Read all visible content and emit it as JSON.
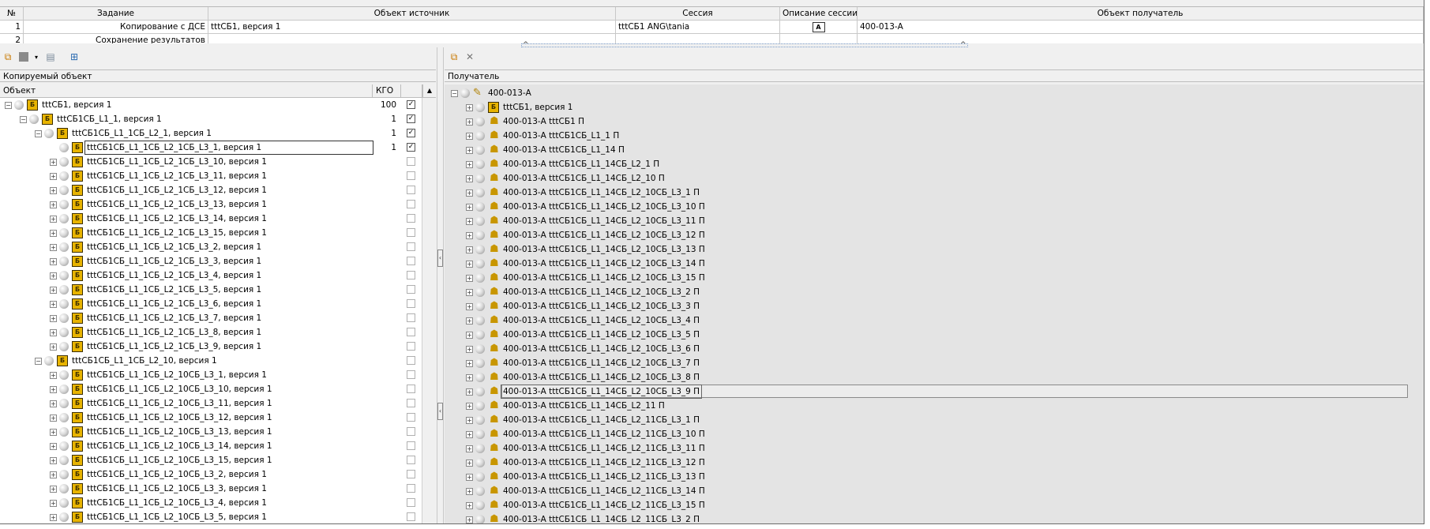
{
  "top_grid": {
    "headers": [
      "№",
      "Задание",
      "Объект источник",
      "Сессия",
      "Описание сессии",
      "Объект получатель"
    ],
    "rows": [
      {
        "num": "1",
        "task": "Копирование с ДСЕ",
        "source": "tttCБ1, версия 1",
        "session": "tttCБ1 ANG\\tania",
        "desc_icon": "A",
        "target": "400-013-А"
      },
      {
        "num": "2",
        "task": "Сохранение результатов",
        "source": "",
        "session": "",
        "desc_icon": "",
        "target": ""
      }
    ]
  },
  "left_panel": {
    "caption": "Копируемый объект",
    "col_object": "Объект",
    "col_kgo": "КГО",
    "rows": [
      {
        "label": "tttCБ1, версия 1",
        "exp": "−",
        "kgo": "100",
        "checked": true
      },
      {
        "label": "tttCБ1CБ_L1_1, версия 1",
        "exp": "−",
        "kgo": "1",
        "checked": true
      },
      {
        "label": "tttCБ1CБ_L1_1CБ_L2_1, версия 1",
        "exp": "−",
        "kgo": "1",
        "checked": true
      },
      {
        "label": "tttCБ1CБ_L1_1CБ_L2_1CБ_L3_1, версия 1",
        "exp": "",
        "kgo": "1",
        "checked": true
      },
      {
        "label": "tttCБ1CБ_L1_1CБ_L2_1CБ_L3_10, версия 1",
        "exp": "+",
        "kgo": "",
        "checked": false
      },
      {
        "label": "tttCБ1CБ_L1_1CБ_L2_1CБ_L3_11, версия 1",
        "exp": "+",
        "kgo": "",
        "checked": false
      },
      {
        "label": "tttCБ1CБ_L1_1CБ_L2_1CБ_L3_12, версия 1",
        "exp": "+",
        "kgo": "",
        "checked": false
      },
      {
        "label": "tttCБ1CБ_L1_1CБ_L2_1CБ_L3_13, версия 1",
        "exp": "+",
        "kgo": "",
        "checked": false
      },
      {
        "label": "tttCБ1CБ_L1_1CБ_L2_1CБ_L3_14, версия 1",
        "exp": "+",
        "kgo": "",
        "checked": false
      },
      {
        "label": "tttCБ1CБ_L1_1CБ_L2_1CБ_L3_15, версия 1",
        "exp": "+",
        "kgo": "",
        "checked": false
      },
      {
        "label": "tttCБ1CБ_L1_1CБ_L2_1CБ_L3_2, версия 1",
        "exp": "+",
        "kgo": "",
        "checked": false
      },
      {
        "label": "tttCБ1CБ_L1_1CБ_L2_1CБ_L3_3, версия 1",
        "exp": "+",
        "kgo": "",
        "checked": false
      },
      {
        "label": "tttCБ1CБ_L1_1CБ_L2_1CБ_L3_4, версия 1",
        "exp": "+",
        "kgo": "",
        "checked": false
      },
      {
        "label": "tttCБ1CБ_L1_1CБ_L2_1CБ_L3_5, версия 1",
        "exp": "+",
        "kgo": "",
        "checked": false
      },
      {
        "label": "tttCБ1CБ_L1_1CБ_L2_1CБ_L3_6, версия 1",
        "exp": "+",
        "kgo": "",
        "checked": false
      },
      {
        "label": "tttCБ1CБ_L1_1CБ_L2_1CБ_L3_7, версия 1",
        "exp": "+",
        "kgo": "",
        "checked": false
      },
      {
        "label": "tttCБ1CБ_L1_1CБ_L2_1CБ_L3_8, версия 1",
        "exp": "+",
        "kgo": "",
        "checked": false
      },
      {
        "label": "tttCБ1CБ_L1_1CБ_L2_1CБ_L3_9, версия 1",
        "exp": "+",
        "kgo": "",
        "checked": false
      },
      {
        "label": "tttCБ1CБ_L1_1CБ_L2_10, версия 1",
        "exp": "−",
        "kgo": "",
        "checked": false
      },
      {
        "label": "tttCБ1CБ_L1_1CБ_L2_10CБ_L3_1, версия 1",
        "exp": "+",
        "kgo": "",
        "checked": false
      },
      {
        "label": "tttCБ1CБ_L1_1CБ_L2_10CБ_L3_10, версия 1",
        "exp": "+",
        "kgo": "",
        "checked": false
      },
      {
        "label": "tttCБ1CБ_L1_1CБ_L2_10CБ_L3_11, версия 1",
        "exp": "+",
        "kgo": "",
        "checked": false
      },
      {
        "label": "tttCБ1CБ_L1_1CБ_L2_10CБ_L3_12, версия 1",
        "exp": "+",
        "kgo": "",
        "checked": false
      },
      {
        "label": "tttCБ1CБ_L1_1CБ_L2_10CБ_L3_13, версия 1",
        "exp": "+",
        "kgo": "",
        "checked": false
      },
      {
        "label": "tttCБ1CБ_L1_1CБ_L2_10CБ_L3_14, версия 1",
        "exp": "+",
        "kgo": "",
        "checked": false
      },
      {
        "label": "tttCБ1CБ_L1_1CБ_L2_10CБ_L3_15, версия 1",
        "exp": "+",
        "kgo": "",
        "checked": false
      },
      {
        "label": "tttCБ1CБ_L1_1CБ_L2_10CБ_L3_2, версия 1",
        "exp": "+",
        "kgo": "",
        "checked": false
      },
      {
        "label": "tttCБ1CБ_L1_1CБ_L2_10CБ_L3_3, версия 1",
        "exp": "+",
        "kgo": "",
        "checked": false
      },
      {
        "label": "tttCБ1CБ_L1_1CБ_L2_10CБ_L3_4, версия 1",
        "exp": "+",
        "kgo": "",
        "checked": false
      },
      {
        "label": "tttCБ1CБ_L1_1CБ_L2_10CБ_L3_5, версия 1",
        "exp": "+",
        "kgo": "",
        "checked": false
      }
    ]
  },
  "right_panel": {
    "caption": "Получатель",
    "rows": [
      {
        "label": "400-013-А",
        "exp": "−",
        "icon": "root"
      },
      {
        "label": "tttCБ1, версия 1",
        "exp": "+",
        "icon": "asm"
      },
      {
        "label": "400-013-А tttCБ1 П",
        "exp": "+",
        "icon": "prt"
      },
      {
        "label": "400-013-А tttCБ1CБ_L1_1 П",
        "exp": "+",
        "icon": "prt"
      },
      {
        "label": "400-013-А tttCБ1CБ_L1_14 П",
        "exp": "+",
        "icon": "prt"
      },
      {
        "label": "400-013-А tttCБ1CБ_L1_14CБ_L2_1 П",
        "exp": "+",
        "icon": "prt"
      },
      {
        "label": "400-013-А tttCБ1CБ_L1_14CБ_L2_10 П",
        "exp": "+",
        "icon": "prt"
      },
      {
        "label": "400-013-А tttCБ1CБ_L1_14CБ_L2_10CБ_L3_1 П",
        "exp": "+",
        "icon": "prt"
      },
      {
        "label": "400-013-А tttCБ1CБ_L1_14CБ_L2_10CБ_L3_10 П",
        "exp": "+",
        "icon": "prt"
      },
      {
        "label": "400-013-А tttCБ1CБ_L1_14CБ_L2_10CБ_L3_11 П",
        "exp": "+",
        "icon": "prt"
      },
      {
        "label": "400-013-А tttCБ1CБ_L1_14CБ_L2_10CБ_L3_12 П",
        "exp": "+",
        "icon": "prt"
      },
      {
        "label": "400-013-А tttCБ1CБ_L1_14CБ_L2_10CБ_L3_13 П",
        "exp": "+",
        "icon": "prt"
      },
      {
        "label": "400-013-А tttCБ1CБ_L1_14CБ_L2_10CБ_L3_14 П",
        "exp": "+",
        "icon": "prt"
      },
      {
        "label": "400-013-А tttCБ1CБ_L1_14CБ_L2_10CБ_L3_15 П",
        "exp": "+",
        "icon": "prt"
      },
      {
        "label": "400-013-А tttCБ1CБ_L1_14CБ_L2_10CБ_L3_2 П",
        "exp": "+",
        "icon": "prt"
      },
      {
        "label": "400-013-А tttCБ1CБ_L1_14CБ_L2_10CБ_L3_3 П",
        "exp": "+",
        "icon": "prt"
      },
      {
        "label": "400-013-А tttCБ1CБ_L1_14CБ_L2_10CБ_L3_4 П",
        "exp": "+",
        "icon": "prt"
      },
      {
        "label": "400-013-А tttCБ1CБ_L1_14CБ_L2_10CБ_L3_5 П",
        "exp": "+",
        "icon": "prt"
      },
      {
        "label": "400-013-А tttCБ1CБ_L1_14CБ_L2_10CБ_L3_6 П",
        "exp": "+",
        "icon": "prt"
      },
      {
        "label": "400-013-А tttCБ1CБ_L1_14CБ_L2_10CБ_L3_7 П",
        "exp": "+",
        "icon": "prt"
      },
      {
        "label": "400-013-А tttCБ1CБ_L1_14CБ_L2_10CБ_L3_8 П",
        "exp": "+",
        "icon": "prt"
      },
      {
        "label": "400-013-А tttCБ1CБ_L1_14CБ_L2_10CБ_L3_9 П",
        "exp": "+",
        "icon": "prt"
      },
      {
        "label": "400-013-А tttCБ1CБ_L1_14CБ_L2_11 П",
        "exp": "+",
        "icon": "prt"
      },
      {
        "label": "400-013-А tttCБ1CБ_L1_14CБ_L2_11CБ_L3_1 П",
        "exp": "+",
        "icon": "prt"
      },
      {
        "label": "400-013-А tttCБ1CБ_L1_14CБ_L2_11CБ_L3_10 П",
        "exp": "+",
        "icon": "prt"
      },
      {
        "label": "400-013-А tttCБ1CБ_L1_14CБ_L2_11CБ_L3_11 П",
        "exp": "+",
        "icon": "prt"
      },
      {
        "label": "400-013-А tttCБ1CБ_L1_14CБ_L2_11CБ_L3_12 П",
        "exp": "+",
        "icon": "prt"
      },
      {
        "label": "400-013-А tttCБ1CБ_L1_14CБ_L2_11CБ_L3_13 П",
        "exp": "+",
        "icon": "prt"
      },
      {
        "label": "400-013-А tttCБ1CБ_L1_14CБ_L2_11CБ_L3_14 П",
        "exp": "+",
        "icon": "prt"
      },
      {
        "label": "400-013-А tttCБ1CБ_L1_14CБ_L2_11CБ_L3_15 П",
        "exp": "+",
        "icon": "prt"
      },
      {
        "label": "400-013-А tttCБ1CБ_L1_14CБ_L2_11CБ_L3_2 П",
        "exp": "+",
        "icon": "prt"
      }
    ]
  }
}
